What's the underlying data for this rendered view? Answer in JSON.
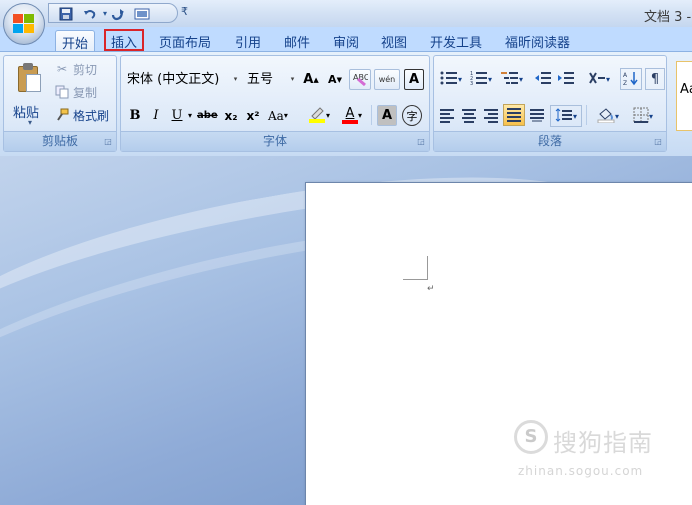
{
  "title_bar": {
    "document_title": "文档 3 -",
    "qat_icons": [
      "save-icon",
      "undo-icon",
      "redo-icon",
      "print-preview-icon"
    ],
    "qat_more": "₹"
  },
  "tabs": [
    {
      "label": "开始",
      "state": "active"
    },
    {
      "label": "插入",
      "state": "highlighted"
    },
    {
      "label": "页面布局"
    },
    {
      "label": "引用"
    },
    {
      "label": "邮件"
    },
    {
      "label": "审阅"
    },
    {
      "label": "视图"
    },
    {
      "label": "开发工具"
    },
    {
      "label": "福昕阅读器"
    }
  ],
  "clipboard": {
    "group_label": "剪贴板",
    "paste_label": "粘贴",
    "cut_label": "剪切",
    "copy_label": "复制",
    "format_painter_label": "格式刷"
  },
  "font": {
    "group_label": "字体",
    "font_name": "宋体 (中文正文)",
    "font_size": "五号",
    "grow_label": "A",
    "shrink_label": "A",
    "clear_format_label": "",
    "phonetic_label": "wén",
    "border_label": "A",
    "bold_label": "B",
    "italic_label": "I",
    "underline_label": "U",
    "strike_label": "abe",
    "subscript_label": "x₂",
    "superscript_label": "x²",
    "case_label": "Aa",
    "font_color_label": "A",
    "shading_label": "A",
    "enclose_label": "字"
  },
  "paragraph": {
    "group_label": "段落"
  },
  "styles": {
    "preview_text": "Aa"
  },
  "document": {
    "paragraph_mark": "↵"
  },
  "watermark": {
    "brand_text": "搜狗指南",
    "url_text": "zhinan.sogou.com",
    "logo_letter": "S"
  },
  "colors": {
    "accent_red": "#d9252a",
    "highlight_yellow": "#ffff00",
    "font_red": "#ff0000",
    "ribbon_blue": "#bfdbff"
  }
}
